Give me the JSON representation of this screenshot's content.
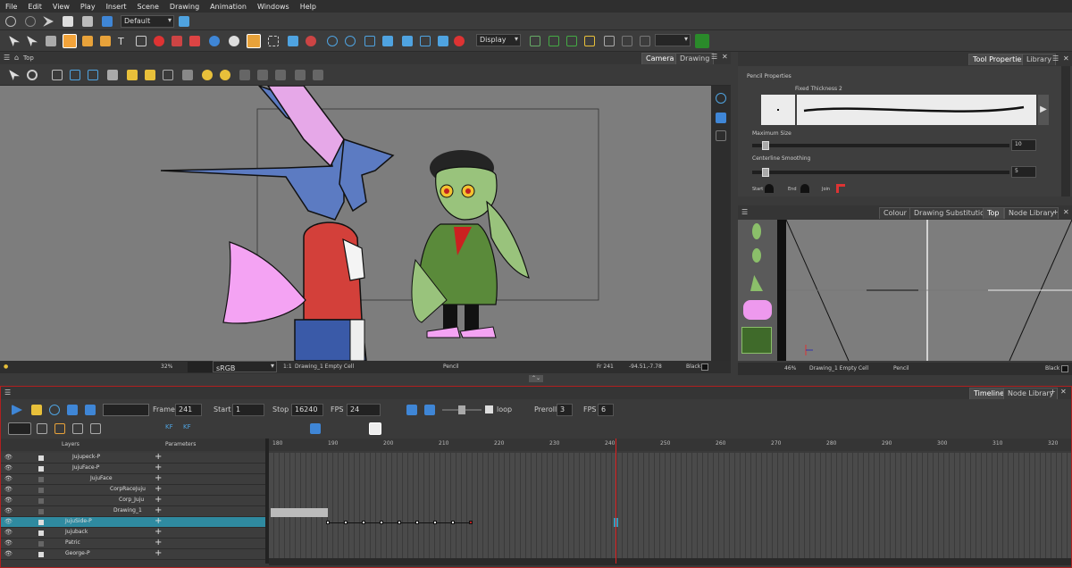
{
  "menu": [
    "File",
    "Edit",
    "View",
    "Play",
    "Insert",
    "Scene",
    "Drawing",
    "Animation",
    "Windows",
    "Help"
  ],
  "toolbar": {
    "workspace": "Default",
    "display": "Display"
  },
  "viewport": {
    "title": "Top",
    "tabs": [
      "Camera",
      "Drawing"
    ],
    "status": {
      "zoom": "32%",
      "colorspace": "sRGB",
      "ratio": "1:1",
      "cell": "Drawing_1 Empty Cell",
      "tool": "Pencil",
      "frame": "Fr 241",
      "coords": "-94.51,-7.78",
      "color": "Black"
    }
  },
  "tool_properties": {
    "tabs": [
      "Tool Properties",
      "Library"
    ],
    "section": "Pencil Properties",
    "preset": "Fixed Thickness 2",
    "max_size_label": "Maximum Size",
    "max_size_value": "10",
    "smoothing_label": "Centerline Smoothing",
    "smoothing_value": "5",
    "caps": [
      "Start",
      "End",
      "Join"
    ],
    "max_size_fraction": 0.04,
    "smoothing_fraction": 0.04
  },
  "side_view": {
    "tabs": [
      "Colour",
      "Drawing Substitutions",
      "Top",
      "Node Library"
    ],
    "status": {
      "zoom": "46%",
      "cell": "Drawing_1 Empty Cell",
      "tool": "Pencil",
      "color": "Black"
    }
  },
  "timeline": {
    "tabs": [
      "Timeline",
      "Node Library"
    ],
    "frame_label": "Frame",
    "frame": "241",
    "start_label": "Start",
    "start": "1",
    "stop_label": "Stop",
    "stop": "16240",
    "fps_label": "FPS",
    "fps": "24",
    "loop_label": "loop",
    "preroll_label": "Preroll",
    "preroll": "3",
    "fps2_label": "FPS",
    "fps2": "6",
    "layers_header": "Layers",
    "params_header": "Parameters",
    "frame_numbers": [
      "180",
      "190",
      "200",
      "210",
      "220",
      "230",
      "240",
      "250",
      "260",
      "270",
      "280",
      "290",
      "300",
      "310",
      "320"
    ],
    "layers": [
      {
        "name": "Jujupeck-P",
        "indent": 80,
        "selected": false,
        "checked": true
      },
      {
        "name": "JujuFace-P",
        "indent": 80,
        "selected": false,
        "checked": true
      },
      {
        "name": "JujuFace",
        "indent": 100,
        "selected": false,
        "checked": false
      },
      {
        "name": "CorpRaceJuju",
        "indent": 122,
        "selected": false,
        "checked": false
      },
      {
        "name": "Corp_Juju",
        "indent": 132,
        "selected": false,
        "checked": false
      },
      {
        "name": "Drawing_1",
        "indent": 126,
        "selected": false,
        "checked": false
      },
      {
        "name": "JujuSide-P",
        "indent": 72,
        "selected": true,
        "checked": true
      },
      {
        "name": "Jujuback",
        "indent": 72,
        "selected": false,
        "checked": true
      },
      {
        "name": "Patric",
        "indent": 72,
        "selected": false,
        "checked": false
      },
      {
        "name": "George-P",
        "indent": 72,
        "selected": false,
        "checked": true
      }
    ]
  }
}
